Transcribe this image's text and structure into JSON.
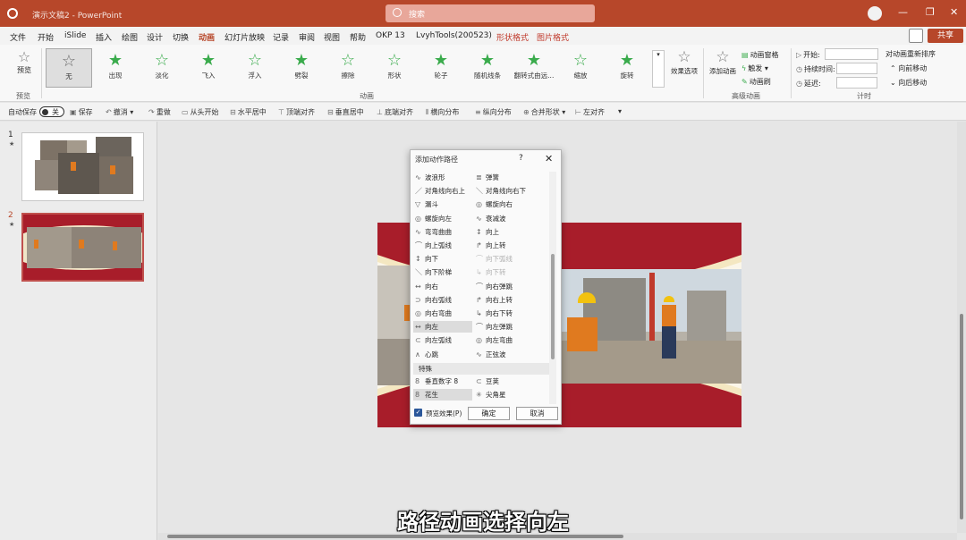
{
  "window": {
    "doc_title": "演示文稿2 - PowerPoint",
    "search_placeholder": "搜索",
    "minimize": "—",
    "restore": "❐",
    "close": "✕"
  },
  "menu": {
    "tabs": [
      "文件",
      "开始",
      "iSlide",
      "插入",
      "绘图",
      "设计",
      "切换",
      "动画",
      "幻灯片放映",
      "记录",
      "审阅",
      "视图",
      "帮助",
      "OKP 13",
      "LvyhTools(200523)"
    ],
    "active_tab": "动画",
    "context_tabs": [
      "形状格式",
      "图片格式"
    ],
    "share": "共享"
  },
  "ribbon": {
    "preview": {
      "label": "预览",
      "group": "预览"
    },
    "animations": [
      {
        "label": "无",
        "selected": true
      },
      {
        "label": "出现"
      },
      {
        "label": "淡化"
      },
      {
        "label": "飞入"
      },
      {
        "label": "浮入"
      },
      {
        "label": "劈裂"
      },
      {
        "label": "擦除"
      },
      {
        "label": "形状"
      },
      {
        "label": "轮子"
      },
      {
        "label": "随机线条"
      },
      {
        "label": "翻转式由远..."
      },
      {
        "label": "缩放"
      },
      {
        "label": "旋转"
      }
    ],
    "animation_group": "动画",
    "effect_options": "效果选项",
    "add_animation": "添加动画",
    "advanced": {
      "pane": "动画窗格",
      "trigger": "触发",
      "painter": "动画刷",
      "group": "高级动画"
    },
    "timing": {
      "start": "开始:",
      "duration": "持续时间:",
      "delay": "延迟:",
      "group": "计时"
    },
    "reorder": {
      "title": "对动画重新排序",
      "earlier": "向前移动",
      "later": "向后移动"
    }
  },
  "qat": {
    "autosave": "自动保存",
    "autosave_state": "关",
    "save": "保存",
    "undo": "撤消",
    "redo": "重做",
    "from_start": "从头开始",
    "align_hcenter": "水平居中",
    "align_top": "顶端对齐",
    "align_vcenter": "垂直居中",
    "align_bottom": "底端对齐",
    "dist_h": "横向分布",
    "dist_v": "纵向分布",
    "merge": "合并形状",
    "align_left": "左对齐"
  },
  "slides": [
    {
      "number": "1",
      "mark": "★"
    },
    {
      "number": "2",
      "mark": "★"
    }
  ],
  "subtitle": "路径动画选择向左",
  "dialog": {
    "title": "添加动作路径",
    "help": "?",
    "close": "✕",
    "items": [
      {
        "label": "波浪形",
        "icon": "∿"
      },
      {
        "label": "弹簧",
        "icon": "≣"
      },
      {
        "label": "对角线向右上",
        "icon": "／"
      },
      {
        "label": "对角线向右下",
        "icon": "＼"
      },
      {
        "label": "漏斗",
        "icon": "▽"
      },
      {
        "label": "螺旋向右",
        "icon": "◎"
      },
      {
        "label": "螺旋向左",
        "icon": "◎"
      },
      {
        "label": "衰减波",
        "icon": "∿"
      },
      {
        "label": "弯弯曲曲",
        "icon": "∿"
      },
      {
        "label": "向上",
        "icon": "↕"
      },
      {
        "label": "向上弧线",
        "icon": "⌒"
      },
      {
        "label": "向上转",
        "icon": "↱"
      },
      {
        "label": "向下",
        "icon": "↕"
      },
      {
        "label": "向下弧线",
        "icon": "⌒",
        "dim": true
      },
      {
        "label": "向下阶梯",
        "icon": "＼"
      },
      {
        "label": "向下转",
        "icon": "↳",
        "dim": true
      },
      {
        "label": "向右",
        "icon": "↔"
      },
      {
        "label": "向右弹跳",
        "icon": "⌒"
      },
      {
        "label": "向右弧线",
        "icon": "⊃"
      },
      {
        "label": "向右上转",
        "icon": "↱"
      },
      {
        "label": "向右弯曲",
        "icon": "◎"
      },
      {
        "label": "向右下转",
        "icon": "↳"
      },
      {
        "label": "向左",
        "icon": "↔",
        "selected": true
      },
      {
        "label": "向左弹跳",
        "icon": "⌒"
      },
      {
        "label": "向左弧线",
        "icon": "⊂"
      },
      {
        "label": "向左弯曲",
        "icon": "◎"
      },
      {
        "label": "心跳",
        "icon": "∧"
      },
      {
        "label": "正弦波",
        "icon": "∿"
      }
    ],
    "section": "特殊",
    "special_items": [
      {
        "label": "垂直数字 8",
        "icon": "8"
      },
      {
        "label": "豆荚",
        "icon": "⊂"
      },
      {
        "label": "花生",
        "icon": "8",
        "selected": true
      },
      {
        "label": "尖角星",
        "icon": "✳"
      }
    ],
    "preview_label": "预览效果(P)",
    "ok": "确定",
    "cancel": "取消"
  }
}
